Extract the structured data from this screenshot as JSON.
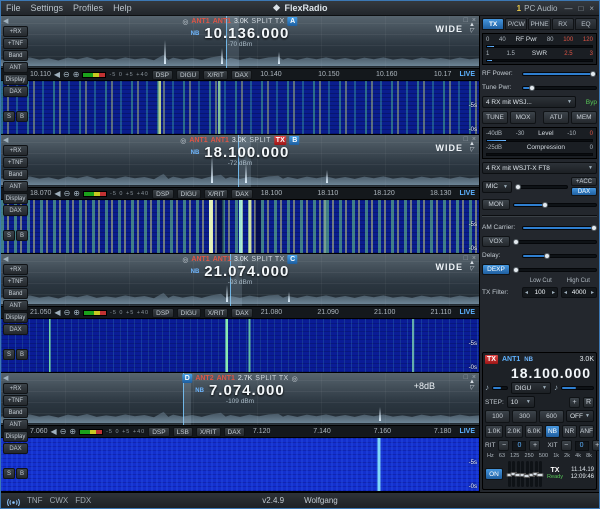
{
  "icons": {
    "brand": "❖",
    "minimize": "—",
    "maximize": "□",
    "close": "×",
    "collapse_left": "◀",
    "zoom_in": "⊕",
    "zoom_out": "⊖",
    "up": "▲",
    "down": "▽",
    "chevron_down": "▼",
    "step_left": "◂",
    "step_right": "▸",
    "minus": "−",
    "plus": "+",
    "lock": "◎",
    "audio": "♪"
  },
  "titlebar": {
    "menus": [
      "File",
      "Settings",
      "Profiles",
      "Help"
    ],
    "brand": "FlexRadio",
    "pc_audio_count": "1",
    "pc_audio": "PC Audio"
  },
  "panadapters": [
    {
      "letter": "A",
      "ant_rx": "ANT1",
      "ant_tx": "ANT1",
      "filter_width": "3.0K",
      "flags": "NB",
      "split_label": "SPLIT TX",
      "tx_label": "",
      "frequency": "10.136.000",
      "signal": "-70 dBm",
      "wide_label": "WIDE",
      "gain_label": "",
      "left_buttons": [
        "+RX",
        "+TNF",
        "Band",
        "ANT",
        "Display",
        "DAX"
      ],
      "mini_buttons": [
        "S",
        "B"
      ],
      "scale_first": "10.110",
      "scale_rest": [
        "10.140",
        "10.150",
        "10.160",
        "10.17"
      ],
      "live_label": "LIVE",
      "db_scale": "-5 0 +5 +40",
      "toolbar": [
        "DSP",
        "DIGU",
        "X/RIT",
        "DAX"
      ],
      "time_mid": "-5s",
      "time_bottom": "-0s"
    },
    {
      "letter": "B",
      "ant_rx": "ANT1",
      "ant_tx": "ANT1",
      "filter_width": "3.0K",
      "flags": "NB",
      "split_label": "SPLIT",
      "tx_label": "TX",
      "frequency": "18.100.000",
      "signal": "-72 dBm",
      "wide_label": "WIDE",
      "gain_label": "",
      "left_buttons": [
        "+RX",
        "+TNF",
        "Band",
        "ANT",
        "Display",
        "DAX"
      ],
      "mini_buttons": [
        "S",
        "B"
      ],
      "scale_first": "18.070",
      "scale_rest": [
        "18.100",
        "18.110",
        "18.120",
        "18.130"
      ],
      "live_label": "LIVE",
      "db_scale": "-5 0 +5 +40",
      "toolbar": [
        "DSP",
        "DIGU",
        "X/RIT",
        "DAX"
      ],
      "time_mid": "-5s",
      "time_bottom": "-0s"
    },
    {
      "letter": "C",
      "ant_rx": "ANT1",
      "ant_tx": "ANT1",
      "filter_width": "3.0K",
      "flags": "NB",
      "split_label": "SPLIT TX",
      "tx_label": "",
      "frequency": "21.074.000",
      "signal": "-93 dBm",
      "wide_label": "WIDE",
      "gain_label": "",
      "left_buttons": [
        "+RX",
        "+TNF",
        "Band",
        "ANT",
        "Display",
        "DAX"
      ],
      "mini_buttons": [
        "S",
        "B"
      ],
      "scale_first": "21.050",
      "scale_rest": [
        "21.080",
        "21.090",
        "21.100",
        "21.110"
      ],
      "live_label": "LIVE",
      "db_scale": "-5 0 +5 +40",
      "toolbar": [
        "DSP",
        "DIGU",
        "X/RIT",
        "DAX"
      ],
      "time_mid": "-5s",
      "time_bottom": "-0s"
    },
    {
      "letter": "D",
      "ant_rx": "ANT2",
      "ant_tx": "ANT1",
      "filter_width": "2.7K",
      "flags": "NB",
      "split_label": "SPLIT TX",
      "tx_label": "",
      "frequency": "7.074.000",
      "signal": "-109 dBm",
      "wide_label": "",
      "gain_label": "+8dB",
      "left_buttons": [
        "+RX",
        "+TNF",
        "Band",
        "ANT",
        "Display",
        "DAX"
      ],
      "mini_buttons": [
        "S",
        "B"
      ],
      "scale_first": "7.060",
      "scale_rest": [
        "7.120",
        "7.140",
        "7.160",
        "7.180"
      ],
      "live_label": "LIVE",
      "db_scale": "-5 0 +5 +40",
      "toolbar": [
        "DSP",
        "LSB",
        "X/RIT",
        "DAX"
      ],
      "time_mid": "-5s",
      "time_bottom": "-0s"
    }
  ],
  "right_panel": {
    "tabs": [
      "TX",
      "P/CW",
      "PHNE",
      "RX",
      "EQ"
    ],
    "rf_meter": {
      "t0": "0",
      "t1": "40",
      "label": "RF Pwr",
      "t2": "80",
      "t3": "100",
      "t4": "120"
    },
    "swr_meter": {
      "t0": "1",
      "t1": "1.5",
      "label": "SWR",
      "t2": "2.5",
      "t3": "3"
    },
    "rf_power_label": "RF Power:",
    "tune_pwr_label": "Tune Pwr:",
    "tx_profile": "4 RX mit WSJ...",
    "byp_label": "Byp",
    "tune_btn": "TUNE",
    "mox_btn": "MOX",
    "atu_btn": "ATU",
    "mem_btn": "MEM",
    "level_meter": {
      "t0": "-40dB",
      "t1": "-30",
      "label": "Level",
      "t2": "-10",
      "t3": "0"
    },
    "comp_meter": {
      "t0": "-25dB",
      "label": "Compression",
      "t1": "0"
    },
    "mic_profile": "4 RX mit WSJT-X FT8",
    "mic_btn": "MIC",
    "acc_btn": "+ACC",
    "dax_btn": "DAX",
    "mon_btn": "MON",
    "am_carrier_label": "AM Carrier:",
    "vox_btn": "VOX",
    "delay_label": "Delay:",
    "dexp_btn": "DEXP",
    "low_cut_label": "Low Cut",
    "high_cut_label": "High Cut",
    "tx_filter_label": "TX Filter:",
    "low_cut_value": "100",
    "high_cut_value": "4000"
  },
  "slice_panel": {
    "tx_badge": "TX",
    "ant": "ANT1",
    "flags": "NB",
    "filter_width": "3.0K",
    "frequency": "18.100.000",
    "mode": "DIGU",
    "step_label": "STEP:",
    "step_value": "10",
    "plus_btn": "+",
    "r_btn": "R",
    "filters_row1": [
      "100",
      "300",
      "600"
    ],
    "off_value": "OFF",
    "filters_row2": [
      "1.0K",
      "2.0K",
      "6.0K"
    ],
    "dsp_buttons": [
      "NB",
      "NR",
      "ANF"
    ],
    "rit_label": "RIT",
    "rit_value": "0",
    "xit_label": "XIT",
    "xit_value": "0",
    "eq_bands": [
      "Hz",
      "63",
      "125",
      "250",
      "500",
      "1k",
      "2k",
      "4k",
      "8k"
    ],
    "on_btn": "ON",
    "tx_status": "TX",
    "ready_status": "Ready",
    "date": "11.14.19",
    "time": "12:09:46"
  },
  "statusbar": {
    "items": [
      "TNF",
      "CWX",
      "FDX"
    ],
    "version": "v2.4.9",
    "profile": "Wolfgang"
  }
}
